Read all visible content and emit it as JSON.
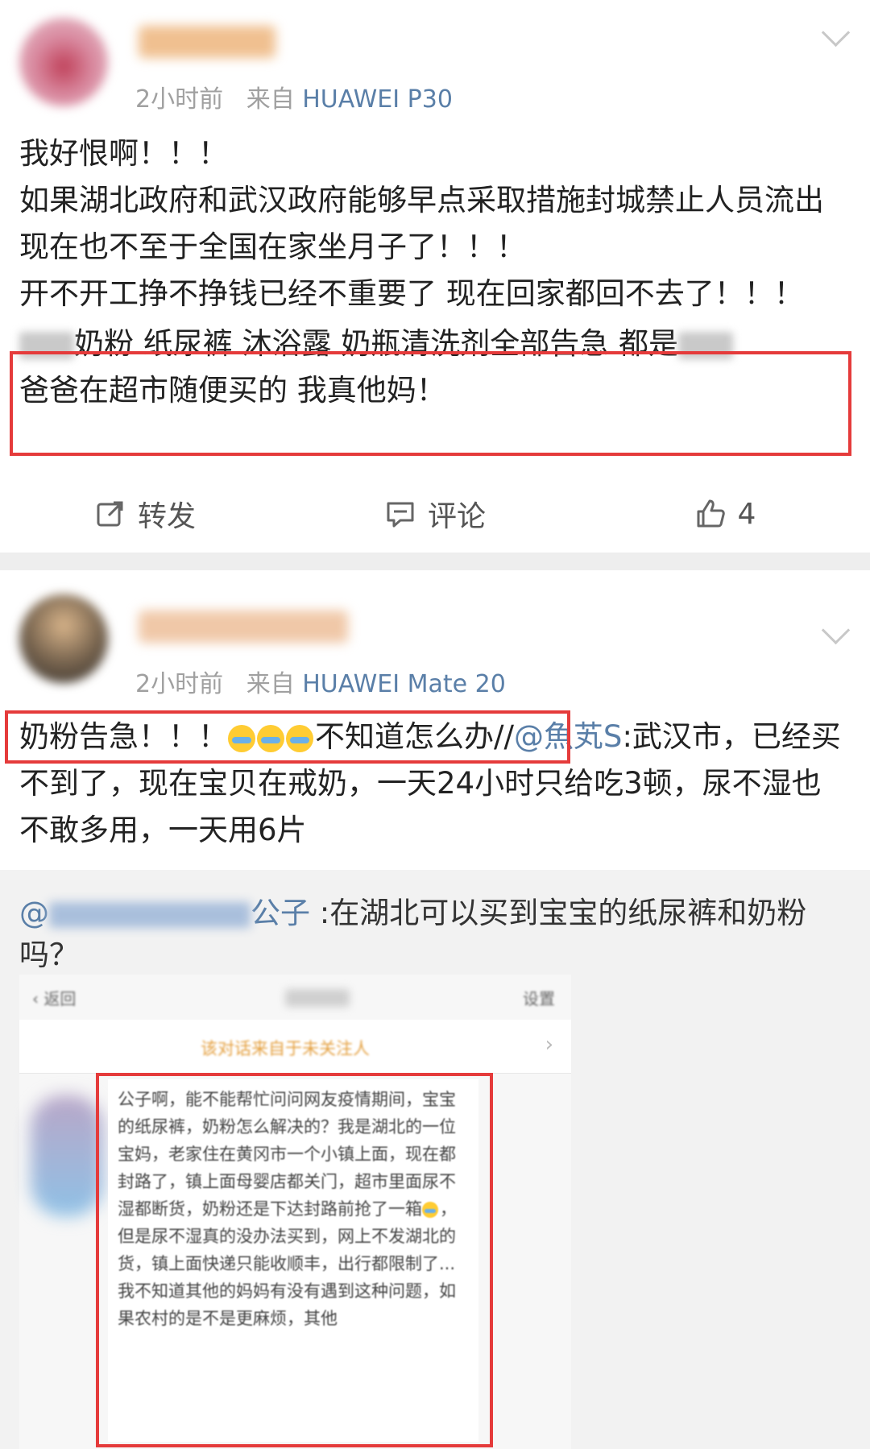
{
  "post1": {
    "time": "2小时前",
    "source_prefix": "来自",
    "device": "HUAWEI P30",
    "text_line1": "我好恨啊！！！",
    "text_line2": "如果湖北政府和武汉政府能够早点采取措施封城禁止人员流出 现在也不至于全国在家坐月子了！！！",
    "text_line3": "开不开工挣不挣钱已经不重要了 现在回家都回不去了！！！",
    "highlight_part1": "奶粉 纸尿裤 沐浴露 奶瓶清洗剂全部告急 都是",
    "highlight_part2": "爸爸在超市随便买的 我真他妈！",
    "actions": {
      "repost": "转发",
      "comment": "评论",
      "like_count": "4"
    }
  },
  "post2": {
    "time": "2小时前",
    "source_prefix": "来自",
    "device": "HUAWEI Mate 20",
    "text_start": "奶粉告急！！！",
    "text_mid": "不知道怎么办",
    "separator": "//",
    "mention": "@魚芄S",
    "text_rest": ":武汉市，已经买不到了，现在宝贝在戒奶，一天24小时只给吃3顿，尿不湿也不敢多用，一天用6片",
    "repost": {
      "mention_suffix": "公子",
      "text": " :在湖北可以买到宝宝的纸尿裤和奶粉吗？",
      "screenshot": {
        "back_label": "返回",
        "right_label": "设置",
        "banner": "该对话来自于未关注人",
        "message_part1": "公子啊，能不能帮忙问问网友疫情期间，宝宝的纸尿裤，奶粉怎么解决的？我是湖北的一位宝妈，老家住在黄冈市一个小镇上面，现在都封路了，镇上面母婴店都关门，超市里面尿不湿都断货，奶粉还是下达封路前抢了一箱",
        "message_part2": "，但是尿不湿真的没办法买到，网上不发湖北的货，镇上面快递只能收顺丰，出行都限制了...我不知道其他的妈妈有没有遇到这种问题，如果农村的是不是更麻烦，其他"
      }
    }
  },
  "colors": {
    "highlight_border": "#e53b3b",
    "link": "#5a7fa8",
    "meta_gray": "#a0a0a0",
    "repost_bg": "#f2f2f2",
    "divider": "#eeeeee"
  },
  "icons": [
    "chevron-down-icon",
    "repost-icon",
    "comment-icon",
    "like-icon",
    "crying-emoji-icon"
  ]
}
